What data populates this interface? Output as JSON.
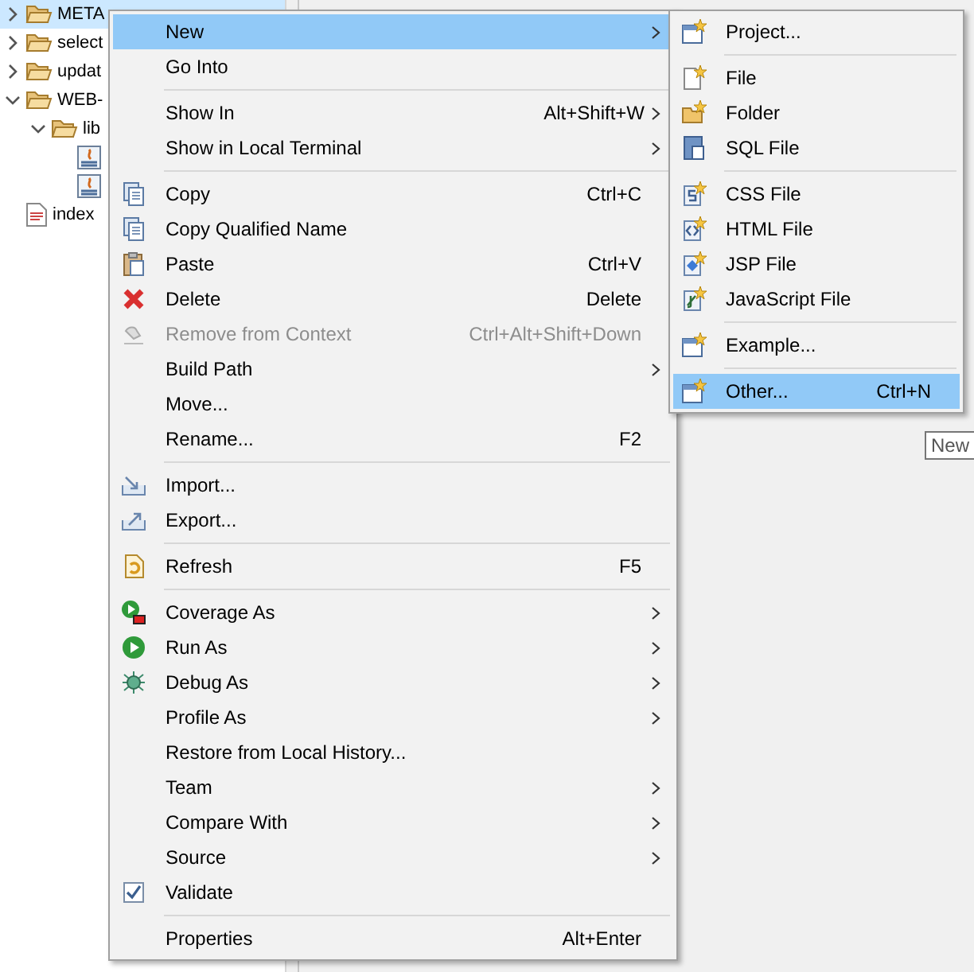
{
  "tree": [
    {
      "label": "META",
      "kind": "folder",
      "expanded": false,
      "selected": true
    },
    {
      "label": "select",
      "kind": "folder",
      "expanded": false,
      "selected": false
    },
    {
      "label": "updat",
      "kind": "folder",
      "expanded": false,
      "selected": false
    },
    {
      "label": "WEB-",
      "kind": "folder",
      "expanded": true,
      "selected": false,
      "children": [
        {
          "label": "lib",
          "kind": "folder",
          "expanded": true,
          "selected": false,
          "children": [
            {
              "kind": "jar",
              "selected": false
            },
            {
              "kind": "jar",
              "selected": false
            }
          ]
        }
      ]
    },
    {
      "label": "index",
      "kind": "file",
      "selected": false
    }
  ],
  "menu": {
    "items": [
      {
        "kind": "item",
        "label": "New",
        "selected": true,
        "submenu": true
      },
      {
        "kind": "item",
        "label": "Go Into",
        "selected": false
      },
      {
        "kind": "separator"
      },
      {
        "kind": "item",
        "label": "Show In",
        "shortcut": "Alt+Shift+W",
        "selected": false,
        "submenu": true
      },
      {
        "kind": "item",
        "label": "Show in Local Terminal",
        "selected": false,
        "submenu": true
      },
      {
        "kind": "separator"
      },
      {
        "kind": "item",
        "label": "Copy",
        "shortcut": "Ctrl+C",
        "selected": false
      },
      {
        "kind": "item",
        "label": "Copy Qualified Name",
        "selected": false
      },
      {
        "kind": "item",
        "label": "Paste",
        "shortcut": "Ctrl+V",
        "selected": false
      },
      {
        "kind": "item",
        "label": "Delete",
        "shortcut": "Delete",
        "selected": false
      },
      {
        "kind": "item",
        "label": "Remove from Context",
        "shortcut": "Ctrl+Alt+Shift+Down",
        "selected": false,
        "disabled": true
      },
      {
        "kind": "item",
        "label": "Build Path",
        "selected": false,
        "submenu": true
      },
      {
        "kind": "item",
        "label": "Move...",
        "selected": false
      },
      {
        "kind": "item",
        "label": "Rename...",
        "shortcut": "F2",
        "selected": false
      },
      {
        "kind": "separator"
      },
      {
        "kind": "item",
        "label": "Import...",
        "selected": false
      },
      {
        "kind": "item",
        "label": "Export...",
        "selected": false
      },
      {
        "kind": "separator"
      },
      {
        "kind": "item",
        "label": "Refresh",
        "shortcut": "F5",
        "selected": false
      },
      {
        "kind": "separator"
      },
      {
        "kind": "item",
        "label": "Coverage As",
        "selected": false,
        "submenu": true
      },
      {
        "kind": "item",
        "label": "Run As",
        "selected": false,
        "submenu": true
      },
      {
        "kind": "item",
        "label": "Debug As",
        "selected": false,
        "submenu": true
      },
      {
        "kind": "item",
        "label": "Profile As",
        "selected": false,
        "submenu": true
      },
      {
        "kind": "item",
        "label": "Restore from Local History...",
        "selected": false
      },
      {
        "kind": "item",
        "label": "Team",
        "selected": false,
        "submenu": true
      },
      {
        "kind": "item",
        "label": "Compare With",
        "selected": false,
        "submenu": true
      },
      {
        "kind": "item",
        "label": "Source",
        "selected": false,
        "submenu": true
      },
      {
        "kind": "item",
        "label": "Validate",
        "selected": false
      },
      {
        "kind": "separator"
      },
      {
        "kind": "item",
        "label": "Properties",
        "shortcut": "Alt+Enter",
        "selected": false
      }
    ]
  },
  "submenu": {
    "items": [
      {
        "kind": "item",
        "label": "Project...",
        "selected": false
      },
      {
        "kind": "separator"
      },
      {
        "kind": "item",
        "label": "File",
        "selected": false
      },
      {
        "kind": "item",
        "label": "Folder",
        "selected": false
      },
      {
        "kind": "item",
        "label": "SQL File",
        "selected": false
      },
      {
        "kind": "separator"
      },
      {
        "kind": "item",
        "label": "CSS File",
        "selected": false
      },
      {
        "kind": "item",
        "label": "HTML File",
        "selected": false
      },
      {
        "kind": "item",
        "label": "JSP File",
        "selected": false
      },
      {
        "kind": "item",
        "label": "JavaScript File",
        "selected": false
      },
      {
        "kind": "separator"
      },
      {
        "kind": "item",
        "label": "Example...",
        "selected": false
      },
      {
        "kind": "separator"
      },
      {
        "kind": "item",
        "label": "Other...",
        "shortcut": "Ctrl+N",
        "selected": true
      }
    ]
  },
  "tooltip": {
    "text": "New"
  }
}
